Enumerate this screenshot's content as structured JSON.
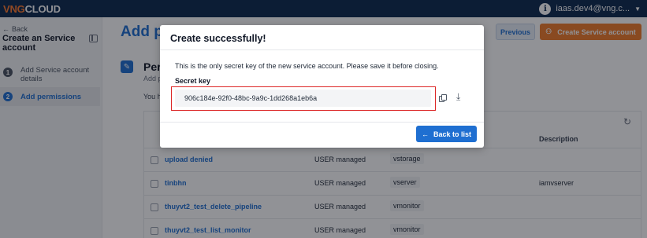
{
  "topbar": {
    "logo_brand": "VNG",
    "logo_suffix": "CLOUD",
    "user_email": "iaas.dev4@vng.c...",
    "info_glyph": "i",
    "caret": "▼"
  },
  "sidebar": {
    "back_label": "Back",
    "title": "Create an Service account",
    "steps": [
      {
        "number": "1",
        "label": "Add Service account details"
      },
      {
        "number": "2",
        "label": "Add permissions"
      }
    ]
  },
  "main": {
    "title": "Add p",
    "previous_button": "Previous",
    "create_button": "Create Service account",
    "permissions_heading": "Per",
    "permissions_sub": "Add p",
    "permissions_you": "You h",
    "table": {
      "description_header": "Description",
      "rows": [
        {
          "name": "upload denied",
          "type": "USER managed",
          "service": "vstorage",
          "description": ""
        },
        {
          "name": "tinbhn",
          "type": "USER managed",
          "service": "vserver",
          "description": "iamvserver"
        },
        {
          "name": "thuyvt2_test_delete_pipeline",
          "type": "USER managed",
          "service": "vmonitor",
          "description": ""
        },
        {
          "name": "thuyvt2_test_list_monitor",
          "type": "USER managed",
          "service": "vmonitor",
          "description": ""
        }
      ]
    }
  },
  "modal": {
    "title": "Create successfully!",
    "message": "This is the only secret key of the new service account. Please save it before closing.",
    "key_label": "Secret key",
    "key_value": "906c184e-92f0-48bc-9a9c-1dd268a1eb6a",
    "back_button": "Back to list"
  },
  "icons": {
    "back": "arrow-left-icon",
    "copy": "copy-icon",
    "download": "download-icon",
    "refresh": "refresh-icon",
    "collapse": "sidebar-collapse-icon",
    "permission": "key-icon",
    "create": "user-add-icon"
  },
  "colors": {
    "topbar": "#0d2a4f",
    "brand_orange": "#f07c2a",
    "primary_blue": "#1f6fd1",
    "highlight_red": "#dc2626"
  }
}
